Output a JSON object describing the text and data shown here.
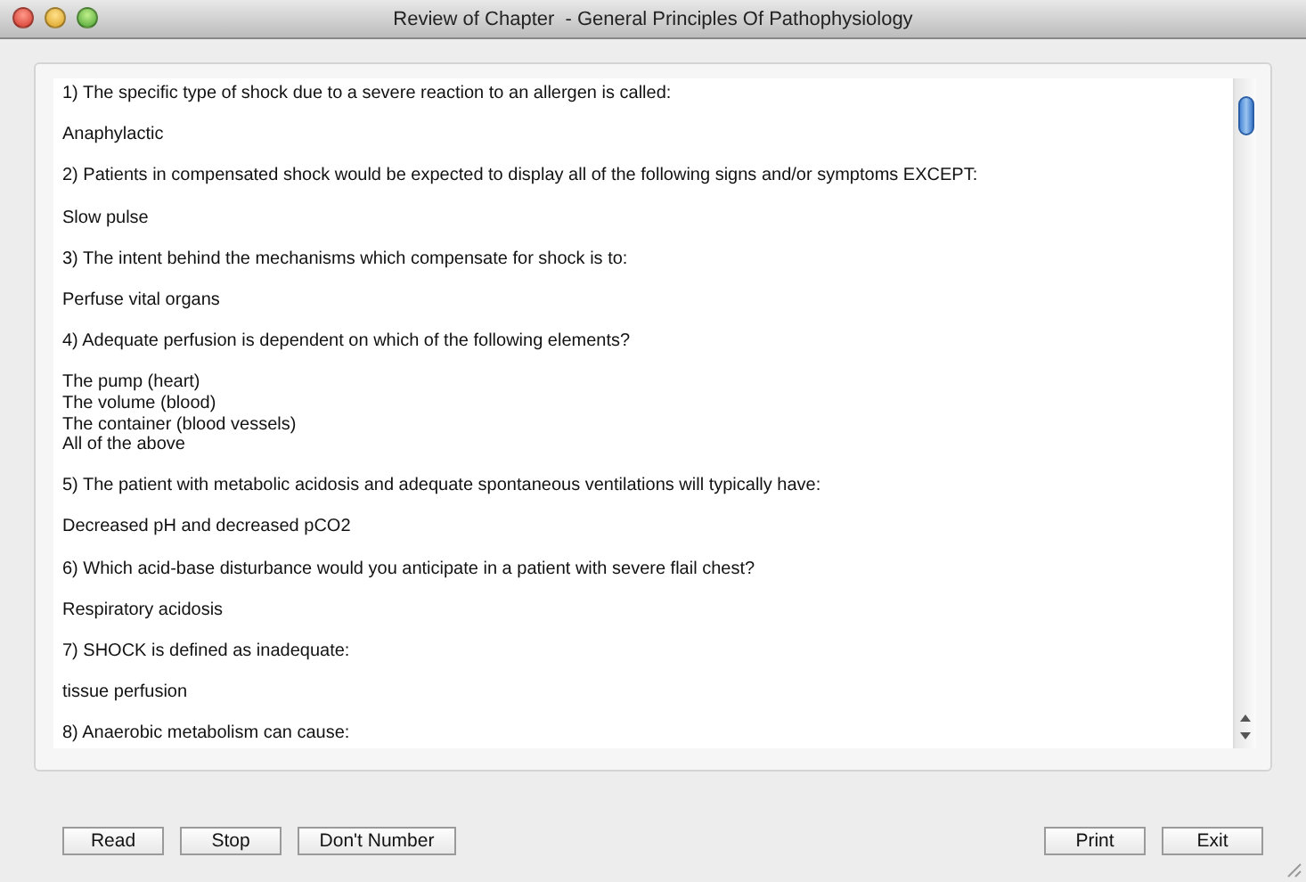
{
  "window": {
    "title": "Review of Chapter  - General Principles Of Pathophysiology"
  },
  "paragraphs": [
    [
      "1) The specific type of shock due to a severe reaction to an allergen is called:"
    ],
    [
      "Anaphylactic"
    ],
    [
      "2) Patients in compensated shock would be expected to display all of the following signs and/or symptoms EXCEPT:"
    ],
    [
      "Slow pulse"
    ],
    [
      "3) The intent behind the mechanisms which compensate for shock is to:"
    ],
    [
      "Perfuse vital organs"
    ],
    [
      "4) Adequate perfusion is dependent on which of the following elements?"
    ],
    [
      "The pump (heart)",
      "The volume (blood)",
      "The container (blood vessels)",
      "All of the above"
    ],
    [
      "5) The patient with metabolic acidosis and adequate spontaneous ventilations will typically have:"
    ],
    [
      "Decreased pH and decreased pCO2"
    ],
    [
      "6) Which acid-base disturbance would you anticipate in a patient with severe flail chest?"
    ],
    [
      "Respiratory acidosis"
    ],
    [
      "7) SHOCK is defined as inadequate:"
    ],
    [
      "tissue perfusion"
    ],
    [
      "8) Anaerobic metabolism can cause:"
    ]
  ],
  "buttons_left": [
    "Read",
    "Stop",
    "Don't Number"
  ],
  "buttons_right": [
    "Print",
    "Exit"
  ]
}
